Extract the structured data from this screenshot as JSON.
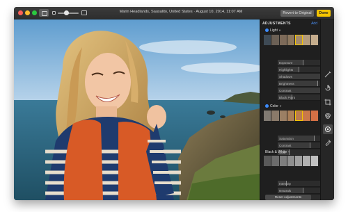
{
  "window": {
    "title": "Marin Headlands, Sausalito, United States  ·  August 10, 2014, 11:07 AM",
    "revert_label": "Revert to Original",
    "done_label": "Done"
  },
  "adjustments": {
    "header": "ADJUSTMENTS",
    "add_label": "Add",
    "light": {
      "title": "Light",
      "caret": "▾",
      "rows": [
        {
          "label": "Exposure",
          "value": "-0.13",
          "level": 0.45
        },
        {
          "label": "Highlights",
          "value": "-0.27",
          "level": 0.38
        },
        {
          "label": "Shadows",
          "value": "0.76",
          "level": 0.88
        },
        {
          "label": "Brightness",
          "value": "0.45",
          "level": 0.72
        },
        {
          "label": "Contrast",
          "value": "0.57",
          "level": 0.78
        },
        {
          "label": "Black Point",
          "value": "",
          "level": 0.25
        }
      ]
    },
    "color": {
      "title": "Color",
      "caret": "▾",
      "rows": [
        {
          "label": "Saturation",
          "value": "0.34",
          "level": 0.66
        },
        {
          "label": "Contrast",
          "value": "0.16",
          "level": 0.58
        },
        {
          "label": "Cast",
          "value": "",
          "level": 0.2
        }
      ]
    },
    "bw": {
      "title": "Black & White",
      "caret": "▾",
      "rows": [
        {
          "label": "Intensity",
          "value": "",
          "level": 0.15
        },
        {
          "label": "Neutrals",
          "value": "",
          "level": 0.45
        },
        {
          "label": "Tone",
          "value": "",
          "level": 0.45
        }
      ]
    },
    "reset_label": "Reset Adjustments"
  },
  "colors": {
    "accent": "#3d8cff",
    "done": "#f4c400",
    "panel_bg": "#1f1f1f"
  }
}
